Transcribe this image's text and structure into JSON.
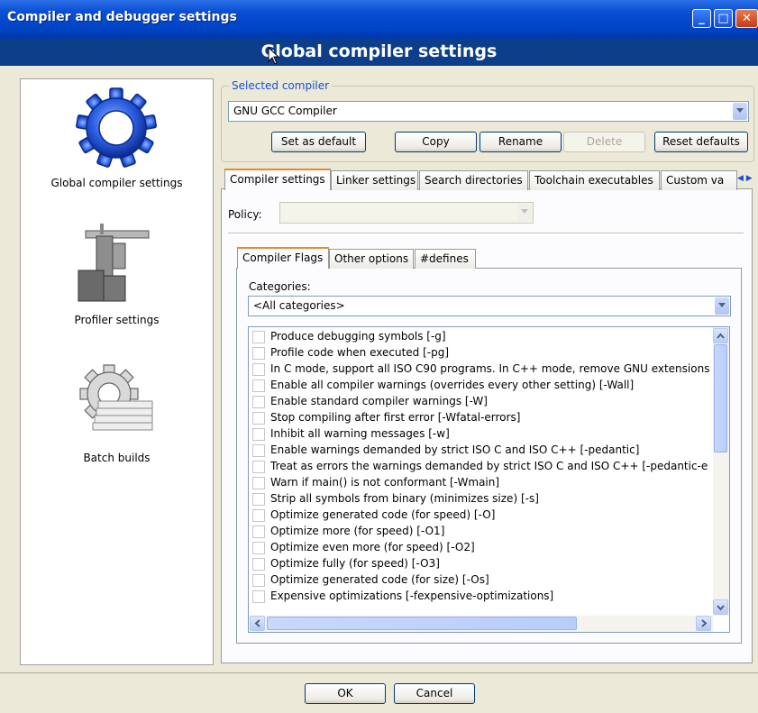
{
  "window": {
    "title": "Compiler and debugger settings",
    "header": "Global compiler settings"
  },
  "sidebar": {
    "items": [
      {
        "label": "Global compiler settings",
        "icon": "gear-icon"
      },
      {
        "label": "Profiler settings",
        "icon": "profiler-icon"
      },
      {
        "label": "Batch builds",
        "icon": "batch-gear-icon"
      }
    ]
  },
  "compiler": {
    "group_label": "Selected compiler",
    "selected": "GNU GCC Compiler",
    "buttons": {
      "set_default": "Set as default",
      "copy": "Copy",
      "rename": "Rename",
      "delete": "Delete",
      "reset": "Reset defaults"
    }
  },
  "tabs": [
    {
      "label": "Compiler settings"
    },
    {
      "label": "Linker settings"
    },
    {
      "label": "Search directories"
    },
    {
      "label": "Toolchain executables"
    },
    {
      "label": "Custom va"
    }
  ],
  "policy": {
    "label": "Policy:",
    "value": ""
  },
  "subtabs": [
    {
      "label": "Compiler Flags"
    },
    {
      "label": "Other options"
    },
    {
      "label": "#defines"
    }
  ],
  "categories": {
    "label": "Categories:",
    "selected": "<All categories>"
  },
  "flags": [
    "Produce debugging symbols [-g]",
    "Profile code when executed [-pg]",
    "In C mode, support all ISO C90 programs. In C++ mode, remove GNU extensions",
    "Enable all compiler warnings (overrides every other setting) [-Wall]",
    "Enable standard compiler warnings [-W]",
    "Stop compiling after first error [-Wfatal-errors]",
    "Inhibit all warning messages [-w]",
    "Enable warnings demanded by strict ISO C and ISO C++ [-pedantic]",
    "Treat as errors the warnings demanded by strict ISO C and ISO C++ [-pedantic-e",
    "Warn if main() is not conformant [-Wmain]",
    "Strip all symbols from binary (minimizes size) [-s]",
    "Optimize generated code (for speed) [-O]",
    "Optimize more (for speed) [-O1]",
    "Optimize even more (for speed) [-O2]",
    "Optimize fully (for speed) [-O3]",
    "Optimize generated code (for size) [-Os]",
    "Expensive optimizations [-fexpensive-optimizations]"
  ],
  "dialog": {
    "ok": "OK",
    "cancel": "Cancel"
  },
  "colors": {
    "titlebar": "#0a4fd4",
    "header": "#0c3e8a",
    "face": "#ece9d8",
    "accent": "#1b4fcf"
  }
}
